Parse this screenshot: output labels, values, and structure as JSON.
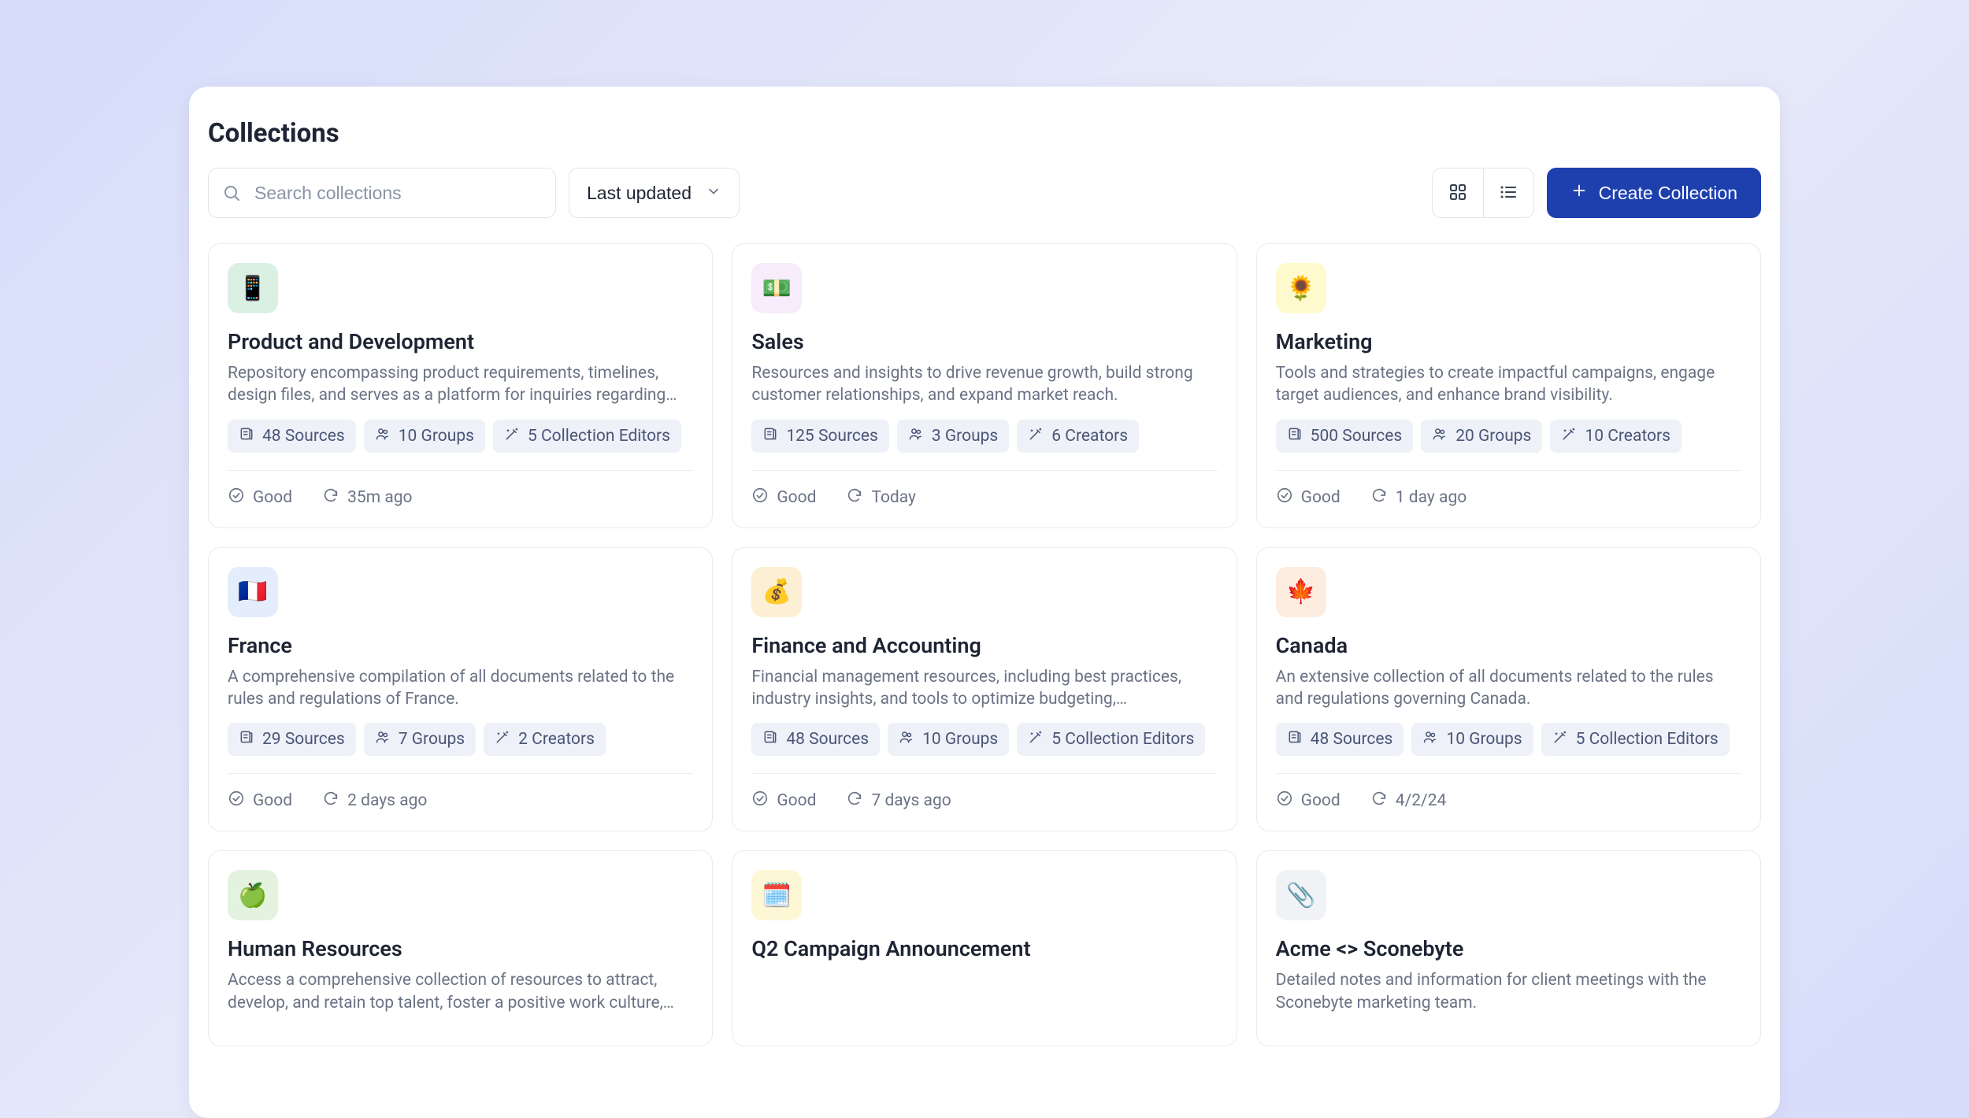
{
  "header": {
    "title": "Collections",
    "search_placeholder": "Search collections",
    "sort_label": "Last updated",
    "create_label": "Create Collection"
  },
  "cards": [
    {
      "emoji": "📱",
      "icon_bg": "#daf0e3",
      "title": "Product and Development",
      "desc": "Repository encompassing product requirements, timelines, design files, and serves as a platform for inquiries regarding ou…",
      "chips": [
        {
          "icon": "sources-icon",
          "label": "48 Sources"
        },
        {
          "icon": "groups-icon",
          "label": "10 Groups"
        },
        {
          "icon": "wand-icon",
          "label": "5 Collection Editors"
        }
      ],
      "status": "Good",
      "updated": "35m ago"
    },
    {
      "emoji": "💵",
      "icon_bg": "#f7ecfb",
      "title": "Sales",
      "desc": "Resources and insights to drive revenue growth, build strong customer relationships, and expand market reach.",
      "chips": [
        {
          "icon": "sources-icon",
          "label": "125 Sources"
        },
        {
          "icon": "groups-icon",
          "label": "3 Groups"
        },
        {
          "icon": "wand-icon",
          "label": "6 Creators"
        }
      ],
      "status": "Good",
      "updated": "Today"
    },
    {
      "emoji": "🌻",
      "icon_bg": "#ffface",
      "title": "Marketing",
      "desc": "Tools and strategies to create impactful campaigns, engage target audiences, and enhance brand visibility.",
      "chips": [
        {
          "icon": "sources-icon",
          "label": "500 Sources"
        },
        {
          "icon": "groups-icon",
          "label": "20 Groups"
        },
        {
          "icon": "wand-icon",
          "label": "10 Creators"
        }
      ],
      "status": "Good",
      "updated": "1 day ago"
    },
    {
      "emoji": "🇫🇷",
      "icon_bg": "#e4edfc",
      "title": "France",
      "desc": "A comprehensive compilation of all documents related to the rules and regulations of France.",
      "chips": [
        {
          "icon": "sources-icon",
          "label": "29 Sources"
        },
        {
          "icon": "groups-icon",
          "label": "7 Groups"
        },
        {
          "icon": "wand-icon",
          "label": "2 Creators"
        }
      ],
      "status": "Good",
      "updated": "2 days ago"
    },
    {
      "emoji": "💰",
      "icon_bg": "#fcefd4",
      "title": "Finance and Accounting",
      "desc": "Financial management resources, including best practices, industry insights, and tools to optimize budgeting, forecasting,…",
      "chips": [
        {
          "icon": "sources-icon",
          "label": "48 Sources"
        },
        {
          "icon": "groups-icon",
          "label": "10 Groups"
        },
        {
          "icon": "wand-icon",
          "label": "5 Collection Editors"
        }
      ],
      "status": "Good",
      "updated": "7 days ago"
    },
    {
      "emoji": "🍁",
      "icon_bg": "#fdece0",
      "title": "Canada",
      "desc": "An extensive collection of all documents related to the rules and regulations governing Canada.",
      "chips": [
        {
          "icon": "sources-icon",
          "label": "48 Sources"
        },
        {
          "icon": "groups-icon",
          "label": "10 Groups"
        },
        {
          "icon": "wand-icon",
          "label": "5 Collection Editors"
        }
      ],
      "status": "Good",
      "updated": "4/2/24"
    },
    {
      "emoji": "🍏",
      "icon_bg": "#e3f3e0",
      "title": "Human Resources",
      "desc": "Access a comprehensive collection of resources to attract, develop, and retain top talent, foster a positive work culture, an…",
      "chips": [],
      "status": "",
      "updated": ""
    },
    {
      "emoji": "🗓️",
      "icon_bg": "#fdf7d6",
      "title": "Q2 Campaign Announcement",
      "desc": "",
      "chips": [],
      "status": "",
      "updated": ""
    },
    {
      "emoji": "📎",
      "icon_bg": "#f0f2f6",
      "title": "Acme <> Sconebyte",
      "desc": "Detailed notes and information for client meetings with the Sconebyte marketing team.",
      "chips": [],
      "status": "",
      "updated": ""
    }
  ]
}
